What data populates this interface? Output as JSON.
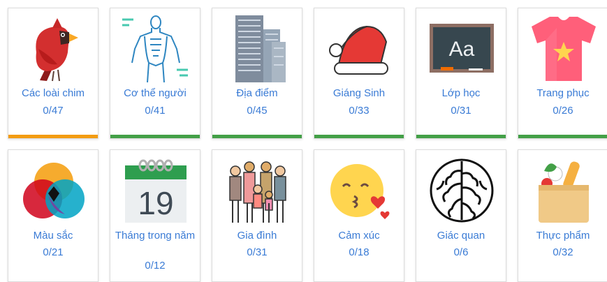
{
  "colors": {
    "orange": "#f39c12",
    "green": "#43a047",
    "text": "#3a7bd5"
  },
  "cards": [
    {
      "title": "Các loài chim",
      "count": "0/47",
      "bar": "orange",
      "icon": "cardinal-bird-icon"
    },
    {
      "title": "Cơ thể người",
      "count": "0/41",
      "bar": "green",
      "icon": "human-body-icon"
    },
    {
      "title": "Địa điểm",
      "count": "0/45",
      "bar": "green",
      "icon": "skyscraper-icon"
    },
    {
      "title": "Giáng Sinh",
      "count": "0/33",
      "bar": "green",
      "icon": "santa-hat-icon"
    },
    {
      "title": "Lớp học",
      "count": "0/31",
      "bar": "green",
      "icon": "chalkboard-icon"
    },
    {
      "title": "Trang phục",
      "count": "0/26",
      "bar": "green",
      "icon": "tshirt-icon"
    },
    {
      "title": "Màu sắc",
      "count": "0/21",
      "icon": "color-circles-icon"
    },
    {
      "title": "Tháng trong năm",
      "count": "0/12",
      "icon": "calendar-icon",
      "calendar_day": "19"
    },
    {
      "title": "Gia đình",
      "count": "0/31",
      "icon": "family-icon"
    },
    {
      "title": "Cảm xúc",
      "count": "0/18",
      "icon": "kiss-emoji-icon"
    },
    {
      "title": "Giác quan",
      "count": "0/6",
      "icon": "brain-icon"
    },
    {
      "title": "Thực phẩm",
      "count": "0/32",
      "icon": "grocery-bag-icon"
    }
  ]
}
